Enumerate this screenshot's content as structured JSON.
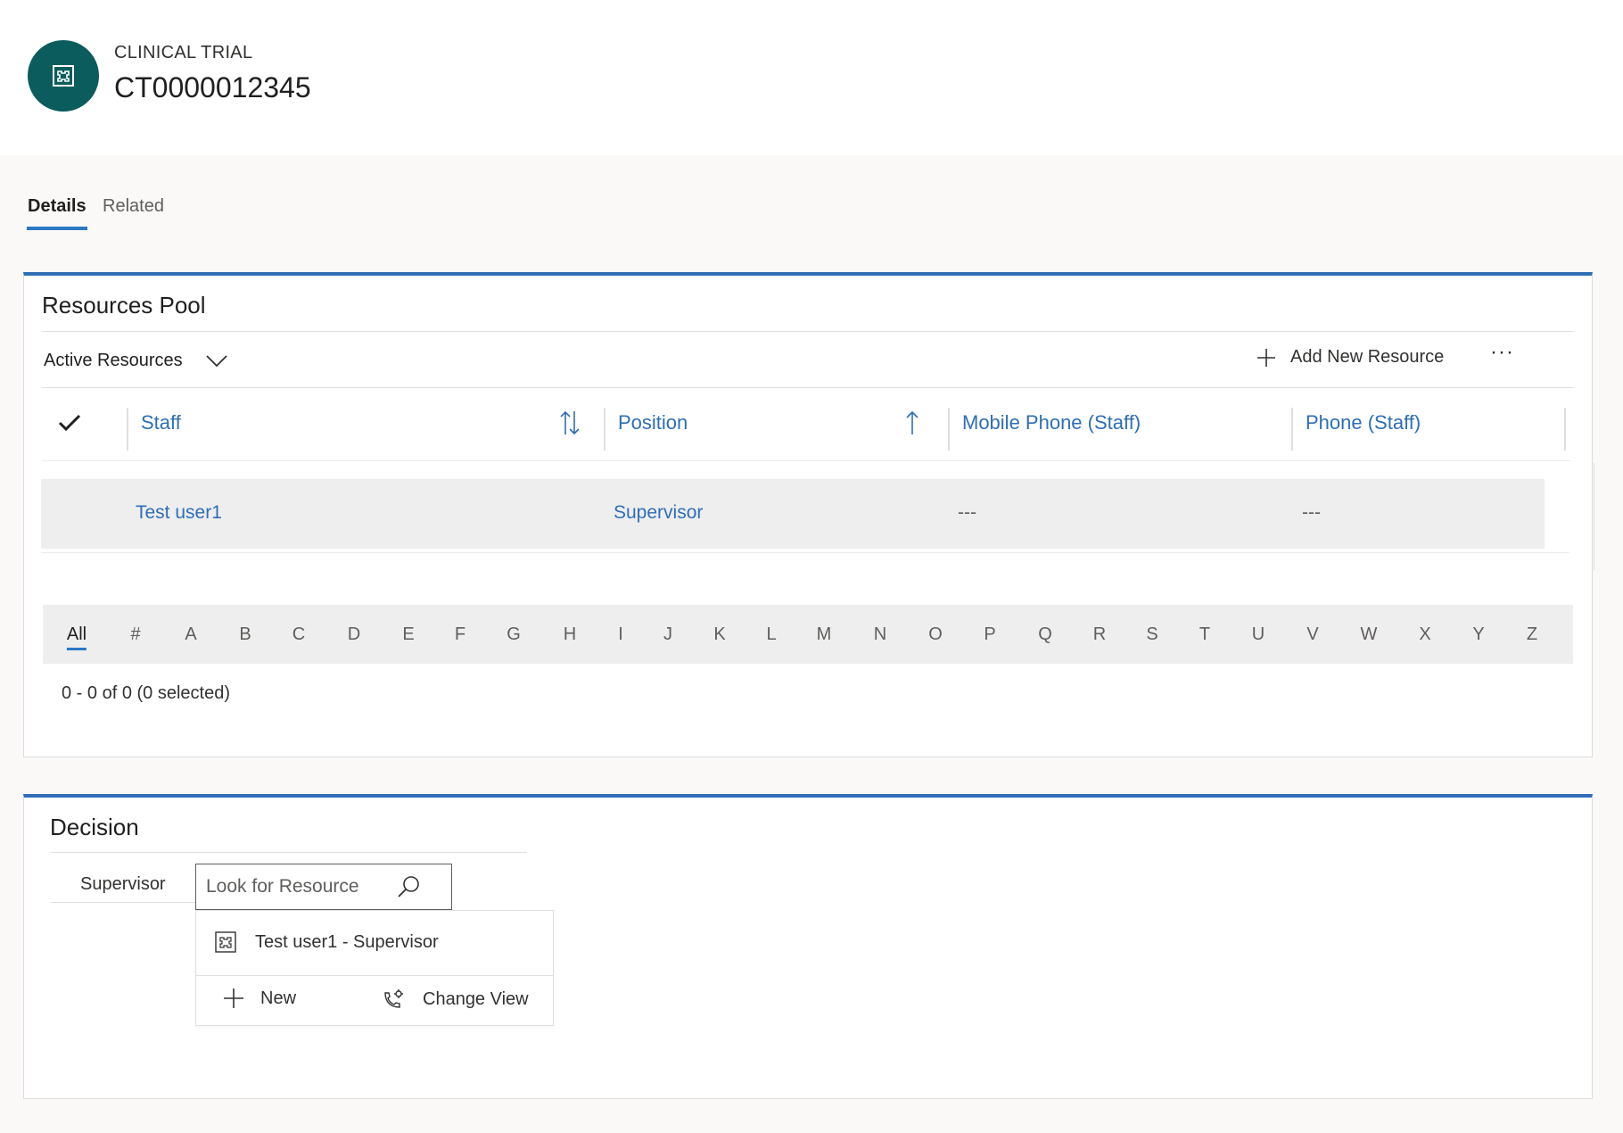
{
  "header": {
    "entity_type": "CLINICAL TRIAL",
    "record_name": "CT0000012345",
    "avatar_icon": "entity-icon"
  },
  "tabs": [
    {
      "label": "Details",
      "selected": true
    },
    {
      "label": "Related",
      "selected": false
    }
  ],
  "resources_pool": {
    "title": "Resources Pool",
    "view_name": "Active Resources",
    "add_label": "Add New Resource",
    "more_label": "···",
    "columns": [
      {
        "label": "Staff",
        "sort": "both"
      },
      {
        "label": "Position",
        "sort": "ascending"
      },
      {
        "label": "Mobile Phone (Staff)"
      },
      {
        "label": "Phone (Staff)"
      }
    ],
    "rows": [
      {
        "staff": "Test user1",
        "position": "Supervisor",
        "mobile_phone": "---",
        "phone": "---"
      }
    ],
    "jump_letters": [
      "All",
      "#",
      "A",
      "B",
      "C",
      "D",
      "E",
      "F",
      "G",
      "H",
      "I",
      "J",
      "K",
      "L",
      "M",
      "N",
      "O",
      "P",
      "Q",
      "R",
      "S",
      "T",
      "U",
      "V",
      "W",
      "X",
      "Y",
      "Z"
    ],
    "status": "0 - 0 of 0 (0 selected)"
  },
  "decision": {
    "title": "Decision",
    "field_label": "Supervisor",
    "lookup_placeholder": "Look for Resource",
    "result_text": "Test user1  -  Supervisor",
    "new_label": "New",
    "change_view_label": "Change View"
  },
  "colors": {
    "accent": "#2f6eb5",
    "avatar_bg": "#0b5c5c",
    "link": "#2f6eb5"
  }
}
